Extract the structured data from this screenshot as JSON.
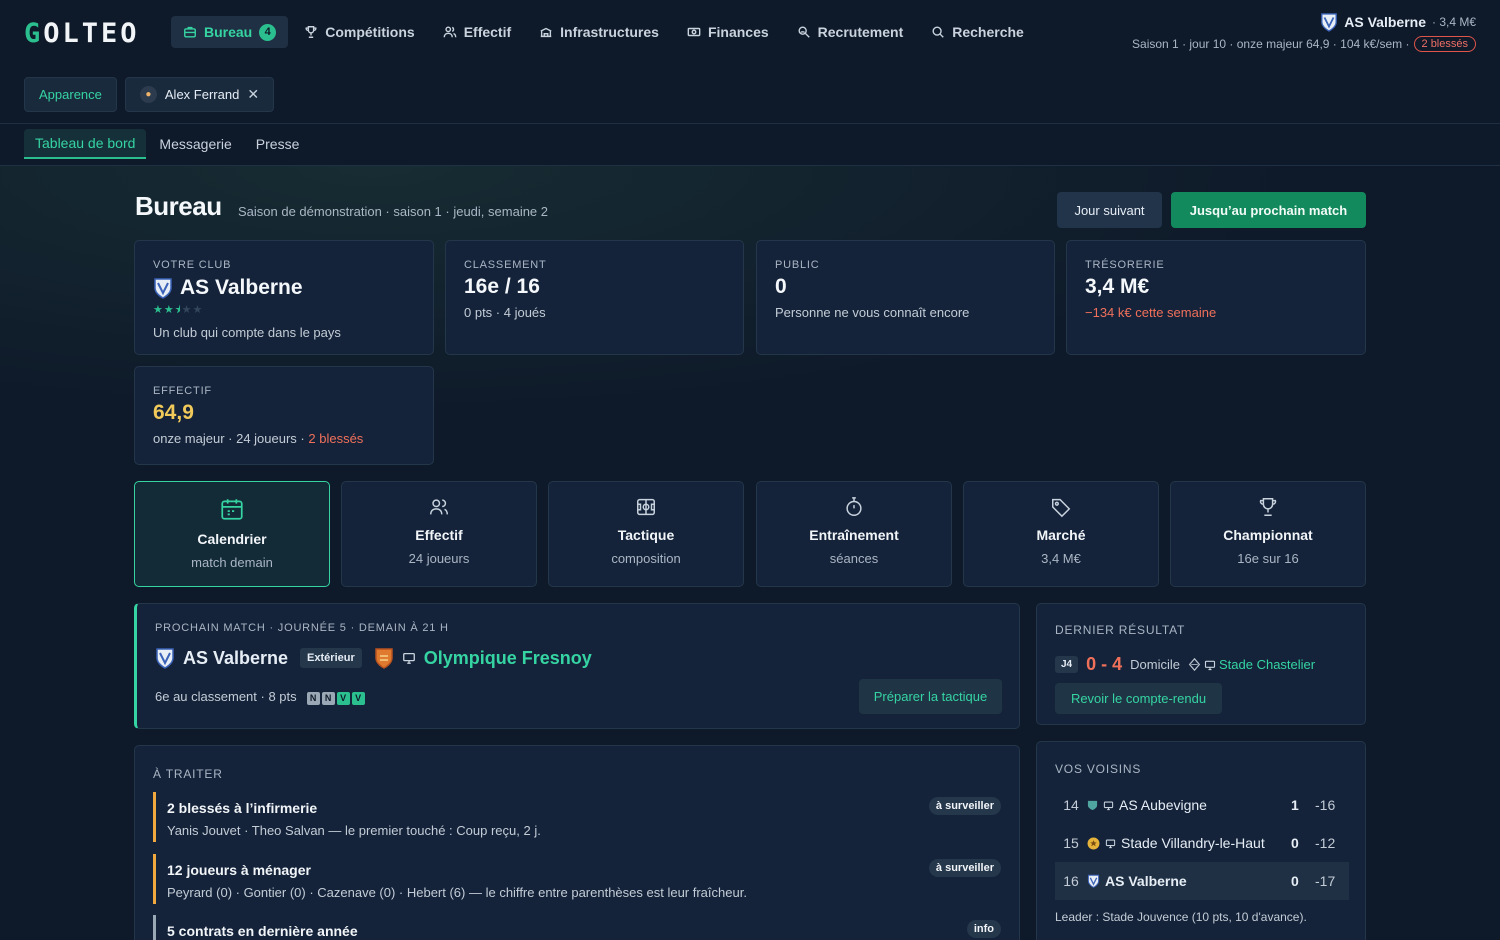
{
  "brand": {
    "logo_first": "G",
    "logo_rest": "OLTEO"
  },
  "nav": {
    "bureau": "Bureau",
    "bureau_count": "4",
    "competitions": "Compétitions",
    "effectif": "Effectif",
    "infrastructures": "Infrastructures",
    "finances": "Finances",
    "recrutement": "Recrutement",
    "recherche": "Recherche"
  },
  "club_top": {
    "name": "AS Valberne",
    "money": "· 3,4 M€",
    "status": "Saison 1 · jour 10 · onze majeur 64,9 · 104 k€/sem ·",
    "injured_pill": "2 blessés"
  },
  "row2": {
    "appearance": "Apparence",
    "manager": "Alex Ferrand"
  },
  "tabs": {
    "dashboard": "Tableau de bord",
    "messages": "Messagerie",
    "press": "Presse"
  },
  "header": {
    "title": "Bureau",
    "subtitle": "Saison de démonstration · saison 1 · jeudi, semaine 2",
    "next_day": "Jour suivant",
    "to_match": "Jusqu’au prochain match"
  },
  "stats": {
    "club": {
      "label": "VOTRE CLUB",
      "value": "AS Valberne",
      "stars": 2.5,
      "sub": "Un club qui compte dans le pays"
    },
    "ranking": {
      "label": "CLASSEMENT",
      "value": "16e / 16",
      "sub": "0 pts · 4 joués"
    },
    "public": {
      "label": "PUBLIC",
      "value": "0",
      "sub": "Personne ne vous connaît encore"
    },
    "treasury": {
      "label": "TRÉSORERIE",
      "value": "3,4 M€",
      "sub": "−134 k€ cette semaine"
    },
    "squad": {
      "label": "EFFECTIF",
      "value": "64,9",
      "sub": "onze majeur · 24 joueurs ·",
      "sub_red": "2 blessés"
    }
  },
  "tiles": [
    {
      "title": "Calendrier",
      "sub": "match demain",
      "icon": "calendar-icon"
    },
    {
      "title": "Effectif",
      "sub": "24 joueurs",
      "icon": "users-icon"
    },
    {
      "title": "Tactique",
      "sub": "composition",
      "icon": "tactic-board-icon"
    },
    {
      "title": "Entraînement",
      "sub": "séances",
      "icon": "stopwatch-icon"
    },
    {
      "title": "Marché",
      "sub": "3,4 M€",
      "icon": "tag-icon"
    },
    {
      "title": "Championnat",
      "sub": "16e sur 16",
      "icon": "trophy-icon"
    }
  ],
  "next_match": {
    "header": "PROCHAIN MATCH · JOURNÉE 5 · DEMAIN À 21 H",
    "home": "AS Valberne",
    "venue_tag": "Extérieur",
    "opponent": "Olympique Fresnoy",
    "opponent_info": "6e au classement · 8 pts",
    "form": [
      "N",
      "N",
      "V",
      "V"
    ],
    "prepare": "Préparer la tactique"
  },
  "last_result": {
    "label": "DERNIER RÉSULTAT",
    "round": "J4",
    "score": "0 - 4",
    "venue": "Domicile",
    "opponent": "Stade Chastelier",
    "review": "Revoir le compte-rendu"
  },
  "todo": {
    "label": "À TRAITER",
    "items": [
      {
        "title": "2 blessés à l’infirmerie",
        "desc": "Yanis Jouvet · Theo Salvan — le premier touché : Coup reçu, 2 j.",
        "tag": "à surveiller"
      },
      {
        "title": "12 joueurs à ménager",
        "desc": "Peyrard (0) · Gontier (0) · Cazenave (0) · Hebert (6) — le chiffre entre parenthèses est leur fraîcheur.",
        "tag": "à surveiller"
      },
      {
        "title": "5 contrats en dernière année",
        "desc": "",
        "tag": "info"
      }
    ]
  },
  "neighbours": {
    "label": "VOS VOISINS",
    "rows": [
      {
        "rank": "14",
        "name": "AS Aubevigne",
        "pts": "1",
        "diff": "-16"
      },
      {
        "rank": "15",
        "name": "Stade Villandry-le-Haut",
        "pts": "0",
        "diff": "-12"
      },
      {
        "rank": "16",
        "name": "AS Valberne",
        "pts": "0",
        "diff": "-17"
      }
    ],
    "leader": "Leader : Stade Jouvence (10 pts, 10 d'avance)."
  },
  "colors": {
    "accent": "#35d4a2",
    "primary_button": "#138a5e",
    "warning": "#f0a93e",
    "danger": "#f0705a",
    "background": "#0e1929"
  }
}
